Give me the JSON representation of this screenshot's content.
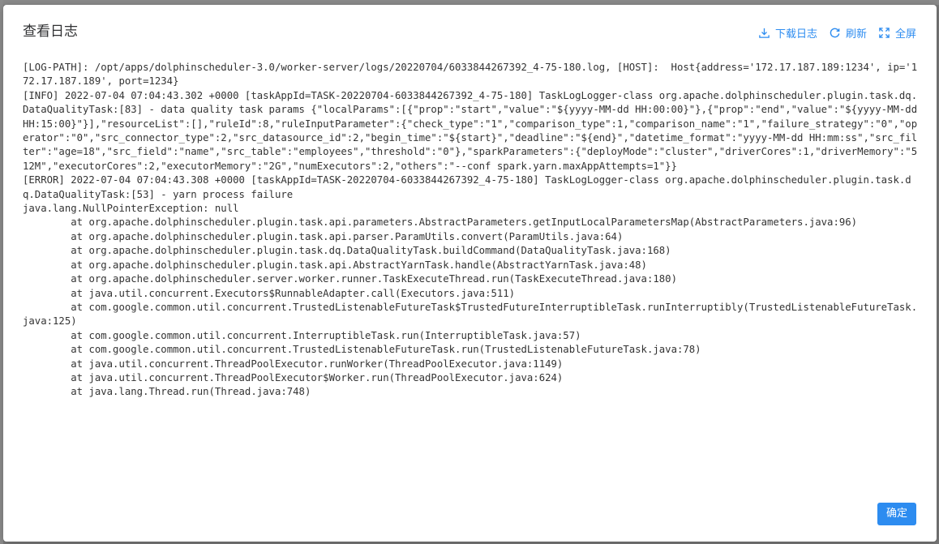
{
  "dialog": {
    "title": "查看日志",
    "toolbar": {
      "download_label": "下载日志",
      "refresh_label": "刷新",
      "fullscreen_label": "全屏"
    },
    "confirm_label": "确定"
  },
  "log": {
    "text": "[LOG-PATH]: /opt/apps/dolphinscheduler-3.0/worker-server/logs/20220704/6033844267392_4-75-180.log, [HOST]:  Host{address='172.17.187.189:1234', ip='172.17.187.189', port=1234}\n[INFO] 2022-07-04 07:04:43.302 +0000 [taskAppId=TASK-20220704-6033844267392_4-75-180] TaskLogLogger-class org.apache.dolphinscheduler.plugin.task.dq.DataQualityTask:[83] - data quality task params {\"localParams\":[{\"prop\":\"start\",\"value\":\"${yyyy-MM-dd HH:00:00}\"},{\"prop\":\"end\",\"value\":\"${yyyy-MM-dd HH:15:00}\"}],\"resourceList\":[],\"ruleId\":8,\"ruleInputParameter\":{\"check_type\":\"1\",\"comparison_type\":1,\"comparison_name\":\"1\",\"failure_strategy\":\"0\",\"operator\":\"0\",\"src_connector_type\":2,\"src_datasource_id\":2,\"begin_time\":\"${start}\",\"deadline\":\"${end}\",\"datetime_format\":\"yyyy-MM-dd HH:mm:ss\",\"src_filter\":\"age=18\",\"src_field\":\"name\",\"src_table\":\"employees\",\"threshold\":\"0\"},\"sparkParameters\":{\"deployMode\":\"cluster\",\"driverCores\":1,\"driverMemory\":\"512M\",\"executorCores\":2,\"executorMemory\":\"2G\",\"numExecutors\":2,\"others\":\"--conf spark.yarn.maxAppAttempts=1\"}}\n[ERROR] 2022-07-04 07:04:43.308 +0000 [taskAppId=TASK-20220704-6033844267392_4-75-180] TaskLogLogger-class org.apache.dolphinscheduler.plugin.task.dq.DataQualityTask:[53] - yarn process failure\njava.lang.NullPointerException: null\n\tat org.apache.dolphinscheduler.plugin.task.api.parameters.AbstractParameters.getInputLocalParametersMap(AbstractParameters.java:96)\n\tat org.apache.dolphinscheduler.plugin.task.api.parser.ParamUtils.convert(ParamUtils.java:64)\n\tat org.apache.dolphinscheduler.plugin.task.dq.DataQualityTask.buildCommand(DataQualityTask.java:168)\n\tat org.apache.dolphinscheduler.plugin.task.api.AbstractYarnTask.handle(AbstractYarnTask.java:48)\n\tat org.apache.dolphinscheduler.server.worker.runner.TaskExecuteThread.run(TaskExecuteThread.java:180)\n\tat java.util.concurrent.Executors$RunnableAdapter.call(Executors.java:511)\n\tat com.google.common.util.concurrent.TrustedListenableFutureTask$TrustedFutureInterruptibleTask.runInterruptibly(TrustedListenableFutureTask.java:125)\n\tat com.google.common.util.concurrent.InterruptibleTask.run(InterruptibleTask.java:57)\n\tat com.google.common.util.concurrent.TrustedListenableFutureTask.run(TrustedListenableFutureTask.java:78)\n\tat java.util.concurrent.ThreadPoolExecutor.runWorker(ThreadPoolExecutor.java:1149)\n\tat java.util.concurrent.ThreadPoolExecutor$Worker.run(ThreadPoolExecutor.java:624)\n\tat java.lang.Thread.run(Thread.java:748)"
  },
  "colors": {
    "accent": "#2d8cf0",
    "title_text": "#303133",
    "log_text": "#333333"
  }
}
